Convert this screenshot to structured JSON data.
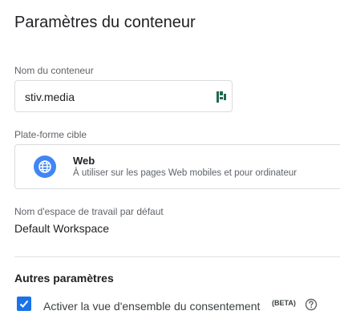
{
  "header": {
    "title": "Paramètres du conteneur"
  },
  "container_name": {
    "label": "Nom du conteneur",
    "value": "stiv.media",
    "icon": "password-manager-icon"
  },
  "target_platform": {
    "label": "Plate-forme cible",
    "name": "Web",
    "description": "À utiliser sur les pages Web mobiles et pour ordinateur",
    "icon": "globe-icon",
    "icon_color": "#4285f4"
  },
  "workspace": {
    "label": "Nom d'espace de travail par défaut",
    "value": "Default Workspace"
  },
  "other_settings": {
    "title": "Autres paramètres",
    "consent_overview": {
      "label": "Activer la vue d'ensemble du consentement",
      "badge": "(BETA)",
      "checked": true,
      "checkbox_color": "#1a73e8",
      "help_icon": "help-circle-icon"
    }
  }
}
